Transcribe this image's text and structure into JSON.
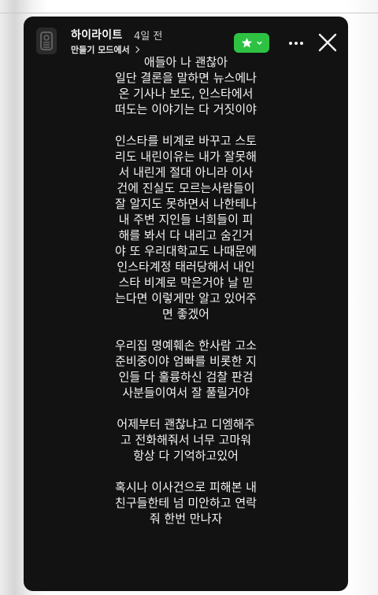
{
  "header": {
    "username": "하이라이트",
    "time_ago": "4일 전",
    "subtitle": "만들기 모드에서",
    "close_friends_icon": "star-icon",
    "close_friends_color": "#2ec243",
    "more_icon": "more-icon",
    "close_icon": "close-icon"
  },
  "story": {
    "background_color": "#121212",
    "paragraphs": [
      {
        "lines": [
          "애들아 나 괜찮아",
          "일단 결론을 말하면 뉴스에나",
          "온 기사나 보도, 인스타에서",
          "떠도는 이야기는 다 거짓이야"
        ]
      },
      {
        "lines": [
          "인스타를 비계로 바꾸고 스토",
          "리도 내린이유는 내가 잘못해",
          "서 내린게 절대 아니라 이사",
          "건에 진실도 모르는사람들이",
          "잘 알지도 못하면서 나한테나",
          "내 주변 지인들 너희들이 피",
          "해를 봐서 다 내리고 숨긴거",
          "야 또 우리대학교도 나때문에",
          "인스타계정 태러당해서 내인",
          "스타 비계로 막은거야 날 믿",
          "는다면 이렇게만 알고 있어주",
          "면 좋겠어"
        ]
      },
      {
        "lines": [
          "우리집 명예훼손 한사람 고소",
          "준비중이야 엄빠를 비롯한 지",
          "인들 다 훌륭하신 검찰 판검",
          "사분들이여서 잘 풀릴거야"
        ]
      },
      {
        "lines": [
          "어제부터 괜찮냐고 디엠해주",
          "고 전화해줘서 너무 고마워",
          "항상 다 기억하고있어"
        ]
      },
      {
        "lines": [
          "혹시나 이사건으로 피해본 내",
          "친구들한테 넘 미안하고 연락",
          "줘 한번 만나자"
        ]
      }
    ]
  }
}
